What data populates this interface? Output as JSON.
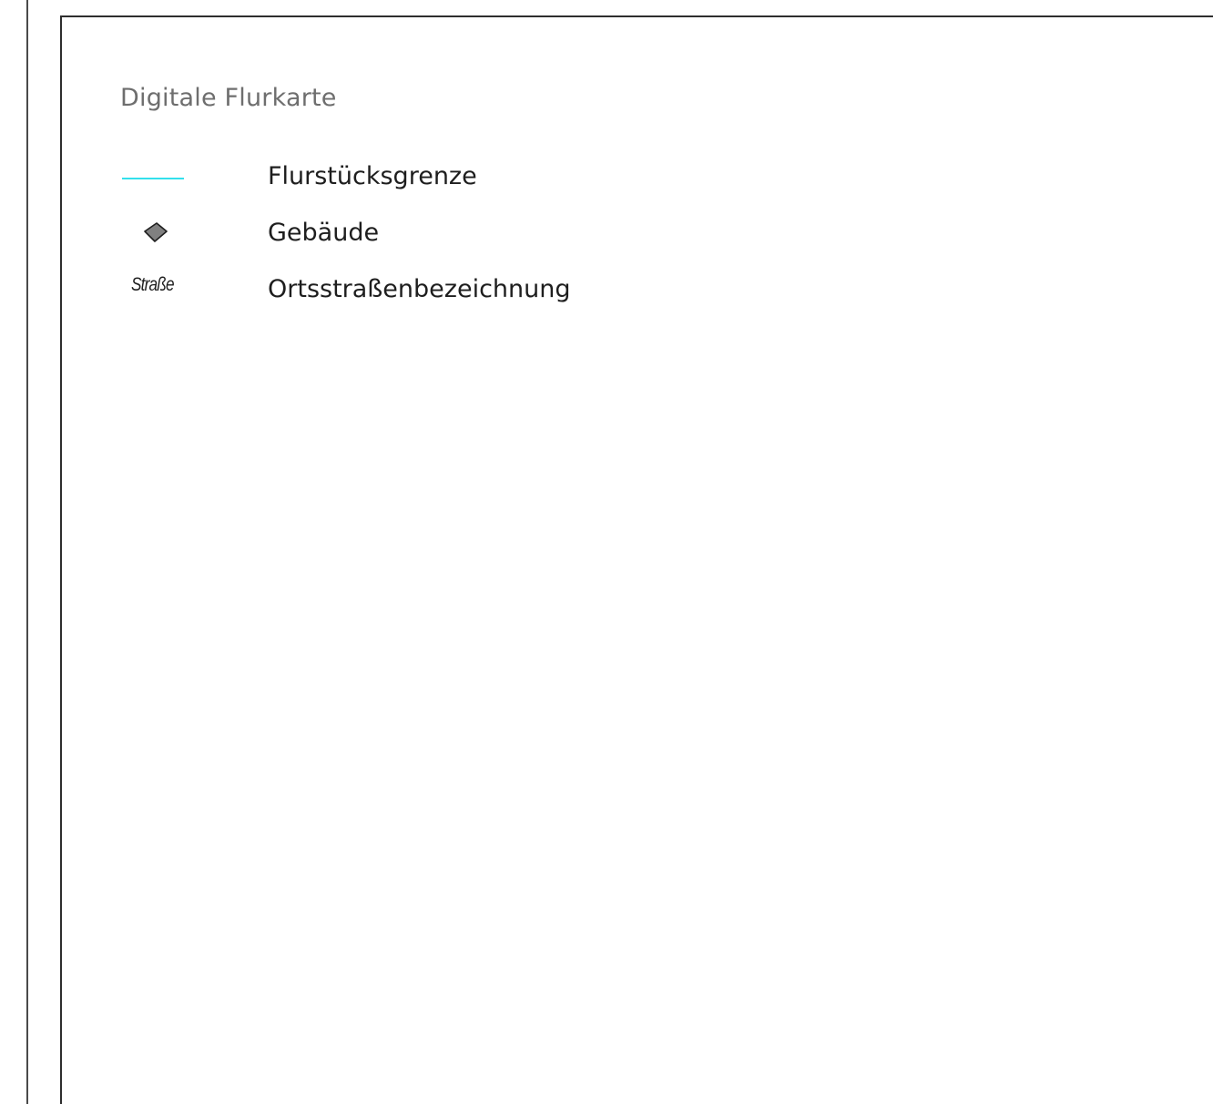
{
  "legend": {
    "title": "Digitale Flurkarte",
    "items": [
      {
        "symbol": "parcel-boundary-line",
        "symbol_color": "#33e0ec",
        "label": "Flurstücksgrenze"
      },
      {
        "symbol": "building-icon",
        "symbol_color": "#808080",
        "label": "Gebäude"
      },
      {
        "symbol": "street-name-sample",
        "symbol_text": "Straße",
        "label": "Ortsstraßenbezeichnung"
      }
    ]
  }
}
